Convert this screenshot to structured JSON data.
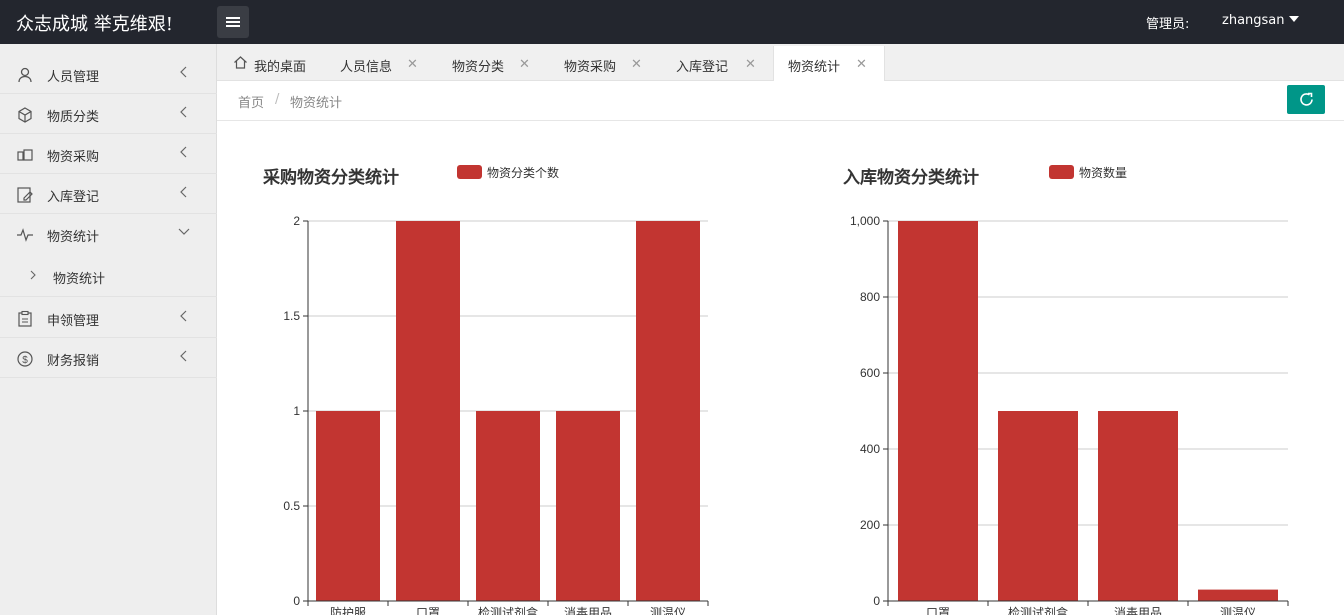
{
  "app": {
    "brand": "众志成城 举克维艰!",
    "admin_label": "管理员:",
    "user_name": "zhangsan"
  },
  "sidebar": {
    "items": [
      {
        "label": "人员管理",
        "icon": "user-icon"
      },
      {
        "label": "物质分类",
        "icon": "cube-icon"
      },
      {
        "label": "物资采购",
        "icon": "cart-icon"
      },
      {
        "label": "入库登记",
        "icon": "edit-icon"
      },
      {
        "label": "物资统计",
        "icon": "pulse-icon"
      },
      {
        "label": "申领管理",
        "icon": "clipboard-icon"
      },
      {
        "label": "财务报销",
        "icon": "dollar-icon"
      }
    ],
    "sub_item": "物资统计"
  },
  "tabs": [
    {
      "label": "我的桌面"
    },
    {
      "label": "人员信息"
    },
    {
      "label": "物资分类"
    },
    {
      "label": "物资采购"
    },
    {
      "label": "入库登记"
    },
    {
      "label": "物资统计"
    }
  ],
  "breadcrumb": {
    "home": "首页",
    "sep": "/",
    "current": "物资统计"
  },
  "colors": {
    "bar": "#c23531",
    "accent": "#009688"
  },
  "chart_data": [
    {
      "type": "bar",
      "title": "采购物资分类统计",
      "legend": "物资分类个数",
      "categories": [
        "防护服",
        "口罩",
        "检测试剂盒",
        "消毒用品",
        "测温仪"
      ],
      "values": [
        1,
        2,
        1,
        1,
        2
      ],
      "ylim": [
        0,
        2
      ],
      "yticks": [
        0,
        0.5,
        1,
        1.5,
        2
      ],
      "ytick_labels": [
        "0",
        "0.5",
        "1",
        "1.5",
        "2"
      ],
      "grid": true
    },
    {
      "type": "bar",
      "title": "入库物资分类统计",
      "legend": "物资数量",
      "categories": [
        "口罩",
        "检测试剂盒",
        "消毒用品",
        "测温仪"
      ],
      "values": [
        1000,
        500,
        500,
        30
      ],
      "ylim": [
        0,
        1000
      ],
      "yticks": [
        0,
        200,
        400,
        600,
        800,
        1000
      ],
      "ytick_labels": [
        "0",
        "200",
        "400",
        "600",
        "800",
        "1,000"
      ],
      "grid": true
    }
  ]
}
